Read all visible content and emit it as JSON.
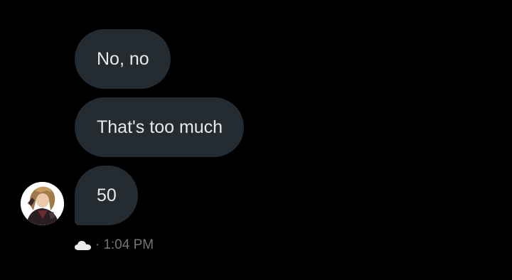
{
  "messages": [
    {
      "text": "No, no"
    },
    {
      "text": "That's too much"
    },
    {
      "text": "50"
    }
  ],
  "meta": {
    "status_icon": "cloud-icon",
    "separator": "·",
    "time": "1:04 PM"
  },
  "colors": {
    "background": "#000000",
    "bubble": "#242b31",
    "bubble_text": "#e7e9ea",
    "meta_text": "#71767b"
  }
}
